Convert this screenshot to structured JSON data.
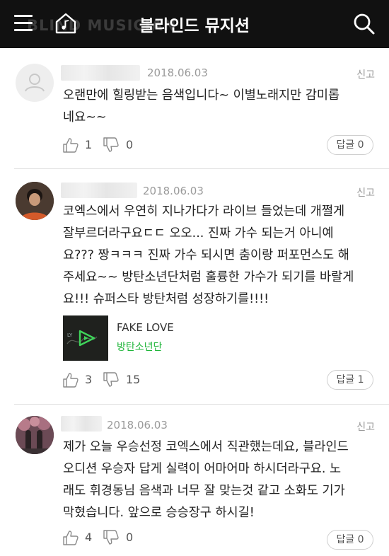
{
  "header": {
    "title": "블라인드 뮤지션",
    "watermark": "BLIND MUSICIAN",
    "menu_icon": "hamburger-menu-icon",
    "logo_icon": "house-music-note-icon",
    "search_icon": "search-icon"
  },
  "comments": [
    {
      "date": "2018.06.03",
      "report": "신고",
      "lines": [
        "오랜만에 힐링받는 음색입니다~ 이별노래지만 감미롭",
        "네요~~"
      ],
      "likes": "1",
      "dislikes": "0",
      "reply": "답글 0"
    },
    {
      "date": "2018.06.03",
      "report": "신고",
      "lines": [
        "코엑스에서 우연히 지나가다가 라이브 들었는데 개쩔게",
        "잘부르더라구요ㄷㄷ 오오... 진짜 가수 되는거 아니예",
        "요??? 짱ㅋㅋㅋ 진짜 가수 되시면 춤이랑 퍼포먼스도 해",
        "주세요~~ 방탄소년단처럼 훌륭한 가수가 되기를 바랄게",
        "요!!! 슈퍼스타 방탄처럼 성장하기를!!!!"
      ],
      "song": {
        "title": "FAKE LOVE",
        "artist": "방탄소년단"
      },
      "likes": "3",
      "dislikes": "15",
      "reply": "답글 1"
    },
    {
      "date": "2018.06.03",
      "report": "신고",
      "lines": [
        "제가 오늘 우승선정 코엑스에서 직관했는데요, 블라인드",
        "오디션 우승자 답게 실력이 어마어마 하시더라구요. 노",
        "래도 휘경동님 음색과 너무 잘 맞는것 같고 소화도 기가",
        "막혔습니다. 앞으로 승승장구 하시길!"
      ],
      "likes": "4",
      "dislikes": "0",
      "reply": "답글 0"
    }
  ],
  "colors": {
    "header_bg": "#111111",
    "artist_green": "#1fb53a",
    "meta_gray": "#9a9a9a"
  }
}
